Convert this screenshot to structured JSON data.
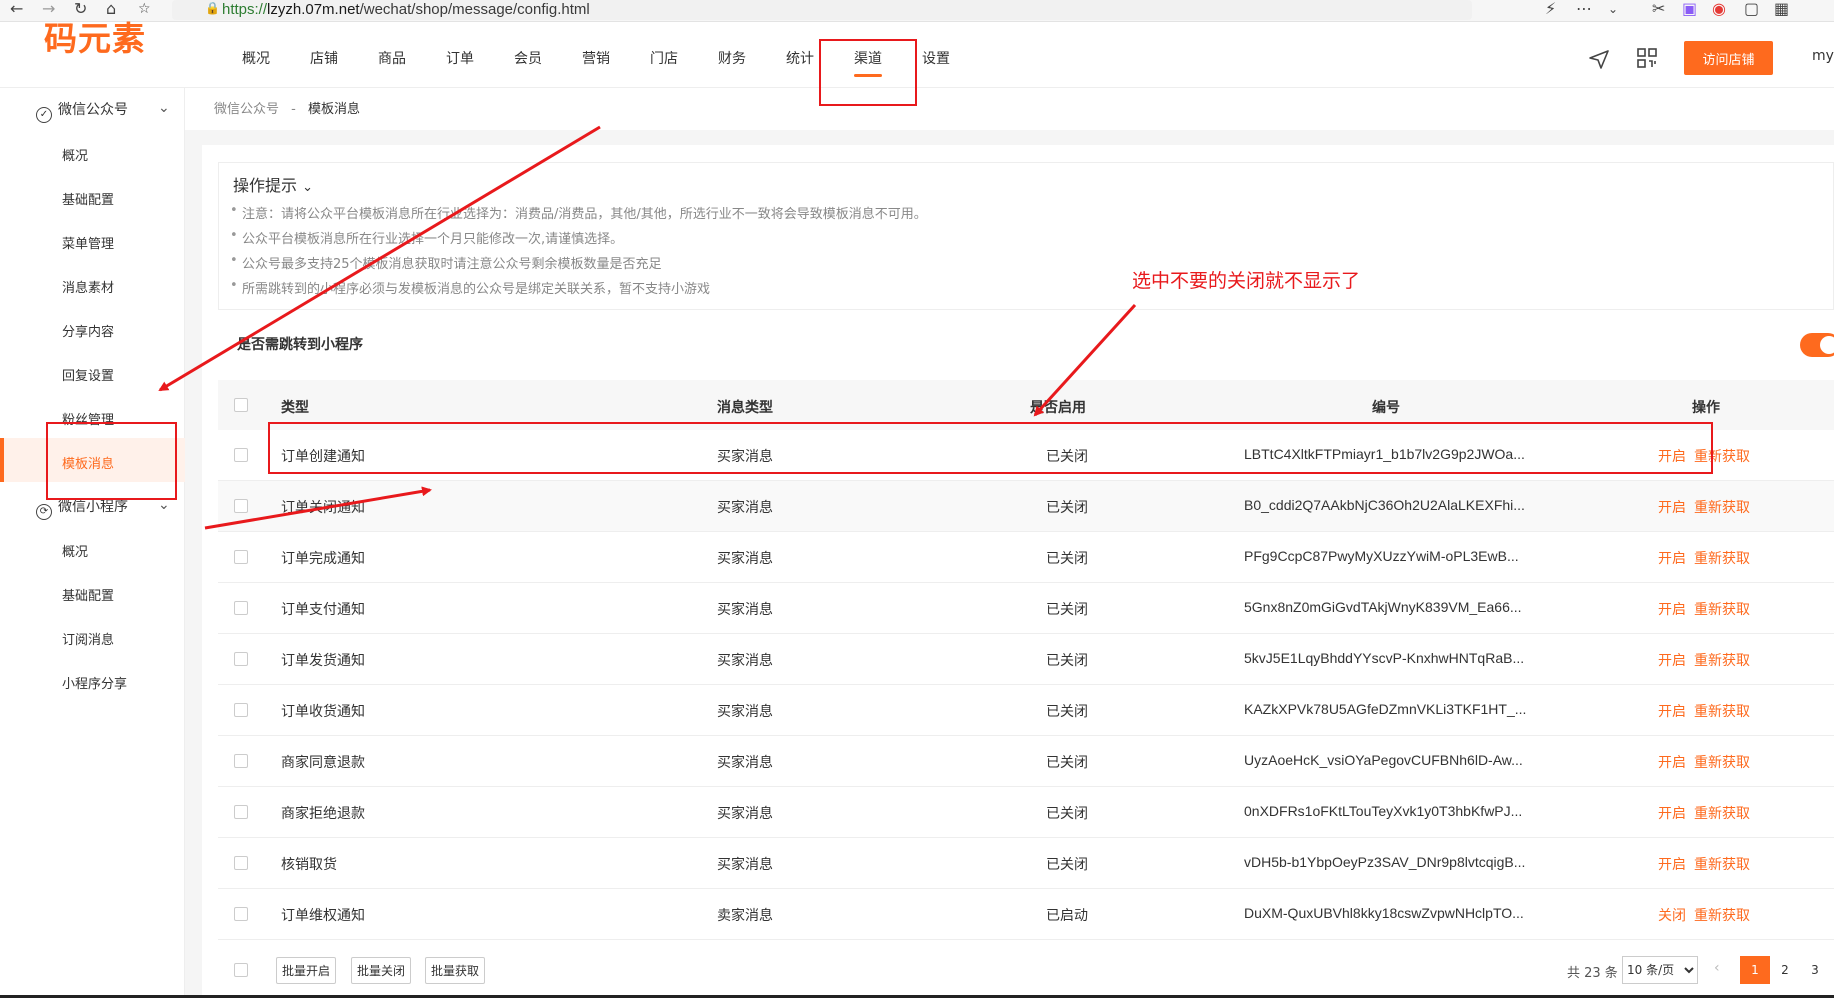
{
  "browser": {
    "url_scheme": "https://",
    "url_host": "lzyzh.07m.net",
    "url_path": "/wechat/shop/message/config.html"
  },
  "header": {
    "logo": "码元素",
    "nav": [
      "概况",
      "店铺",
      "商品",
      "订单",
      "会员",
      "营销",
      "门店",
      "财务",
      "统计",
      "渠道",
      "设置"
    ],
    "active_nav": "渠道",
    "visit_store": "访问店铺",
    "user": "mys"
  },
  "sidebar": {
    "group1": "微信公众号",
    "group1_items": [
      "概况",
      "基础配置",
      "菜单管理",
      "消息素材",
      "分享内容",
      "回复设置",
      "粉丝管理",
      "模板消息"
    ],
    "group2": "微信小程序",
    "group2_items": [
      "概况",
      "基础配置",
      "订阅消息",
      "小程序分享"
    ],
    "active_item": "模板消息"
  },
  "breadcrumb": {
    "parent": "微信公众号",
    "sep": "-",
    "current": "模板消息"
  },
  "tips": {
    "title": "操作提示",
    "items": [
      "注意：请将公众平台模板消息所在行业选择为：消费品/消费品，其他/其他，所选行业不一致将会导致模板消息不可用。",
      "公众平台模板消息所在行业选择一个月只能修改一次,请谨慎选择。",
      "公众号最多支持25个模板消息获取时请注意公众号剩余模板数量是否充足",
      "所需跳转到的小程序必须与发模板消息的公众号是绑定关联关系，暂不支持小游戏"
    ]
  },
  "jump_label": "是否需跳转到小程序",
  "table": {
    "headers": [
      "类型",
      "消息类型",
      "是否启用",
      "编号",
      "操作"
    ],
    "rows": [
      {
        "type": "订单创建通知",
        "msg": "买家消息",
        "status": "已关闭",
        "code": "LBTtC4XltkFTPmiayr1_b1b7lv2G9p2JWOa...",
        "op1": "开启",
        "op2": "重新获取"
      },
      {
        "type": "订单关闭通知",
        "msg": "买家消息",
        "status": "已关闭",
        "code": "B0_cddi2Q7AAkbNjC36Oh2U2AlaLKEXFhi...",
        "op1": "开启",
        "op2": "重新获取"
      },
      {
        "type": "订单完成通知",
        "msg": "买家消息",
        "status": "已关闭",
        "code": "PFg9CcpC87PwyMyXUzzYwiM-oPL3EwB...",
        "op1": "开启",
        "op2": "重新获取"
      },
      {
        "type": "订单支付通知",
        "msg": "买家消息",
        "status": "已关闭",
        "code": "5Gnx8nZ0mGiGvdTAkjWnyK839VM_Ea66...",
        "op1": "开启",
        "op2": "重新获取"
      },
      {
        "type": "订单发货通知",
        "msg": "买家消息",
        "status": "已关闭",
        "code": "5kvJ5E1LqyBhddYYscvP-KnxhwHNTqRaB...",
        "op1": "开启",
        "op2": "重新获取"
      },
      {
        "type": "订单收货通知",
        "msg": "买家消息",
        "status": "已关闭",
        "code": "KAZkXPVk78U5AGfeDZmnVKLi3TKF1HT_...",
        "op1": "开启",
        "op2": "重新获取"
      },
      {
        "type": "商家同意退款",
        "msg": "买家消息",
        "status": "已关闭",
        "code": "UyzAoeHcK_vsiOYaPegovCUFBNh6lD-Aw...",
        "op1": "开启",
        "op2": "重新获取"
      },
      {
        "type": "商家拒绝退款",
        "msg": "买家消息",
        "status": "已关闭",
        "code": "0nXDFRs1oFKtLTouTeyXvk1y0T3hbKfwPJ...",
        "op1": "开启",
        "op2": "重新获取"
      },
      {
        "type": "核销取货",
        "msg": "买家消息",
        "status": "已关闭",
        "code": "vDH5b-b1YbpOeyPz3SAV_DNr9p8lvtcqigB...",
        "op1": "开启",
        "op2": "重新获取"
      },
      {
        "type": "订单维权通知",
        "msg": "卖家消息",
        "status": "已启动",
        "code": "DuXM-QuxUBVhl8kky18cswZvpwNHclpTO...",
        "op1": "关闭",
        "op2": "重新获取"
      }
    ]
  },
  "footer": {
    "batch_open": "批量开启",
    "batch_close": "批量关闭",
    "batch_fetch": "批量获取",
    "total": "共 23 条",
    "page_size": "10 条/页",
    "pages": [
      "1",
      "2",
      "3"
    ],
    "current_page": "1"
  },
  "annotation": {
    "note": "选中不要的关闭就不显示了"
  },
  "colors": {
    "accent": "#fe6a1e",
    "annotation": "#e8191c"
  }
}
